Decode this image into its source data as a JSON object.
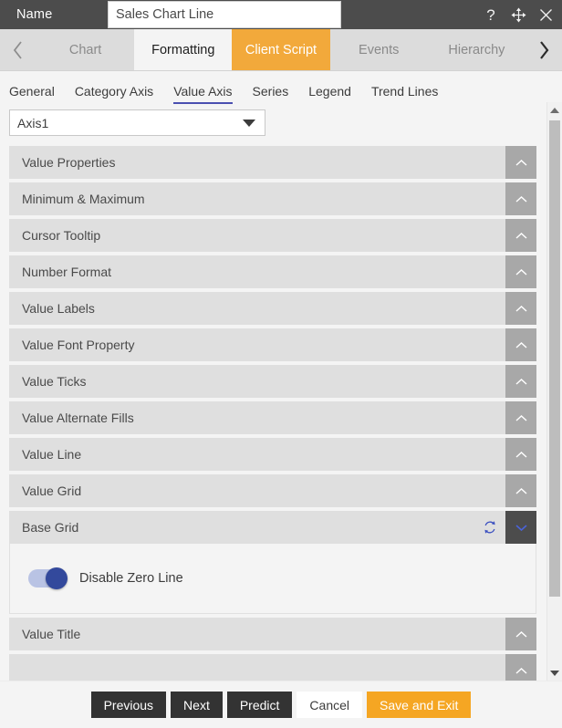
{
  "titlebar": {
    "name_label": "Name",
    "name_value": "Sales Chart Line",
    "name_placeholder": "Name",
    "help_icon": "question-mark-icon",
    "move_icon": "move-icon",
    "close_icon": "close-icon"
  },
  "tabstrip": {
    "prev_icon": "chevron-left-icon",
    "next_icon": "chevron-right-icon",
    "tabs": [
      {
        "label": "Chart",
        "state": "inactive"
      },
      {
        "label": "Formatting",
        "state": "active"
      },
      {
        "label": "Client Script",
        "state": "highlight"
      },
      {
        "label": "Events",
        "state": "inactive"
      },
      {
        "label": "Hierarchy",
        "state": "inactive"
      }
    ]
  },
  "subtabs": {
    "items": [
      {
        "label": "General",
        "active": false
      },
      {
        "label": "Category Axis",
        "active": false
      },
      {
        "label": "Value Axis",
        "active": true
      },
      {
        "label": "Series",
        "active": false
      },
      {
        "label": "Legend",
        "active": false
      },
      {
        "label": "Trend Lines",
        "active": false
      }
    ],
    "underline_color": "#4a4fb0"
  },
  "axis_select": {
    "value": "Axis1",
    "caret_icon": "caret-down-icon"
  },
  "accordion": {
    "collapse_icon": "chevron-up-icon",
    "expand_icon": "chevron-down-icon",
    "refresh_icon": "refresh-icon",
    "sections": [
      {
        "label": "Value Properties",
        "expanded": false
      },
      {
        "label": "Minimum & Maximum",
        "expanded": false
      },
      {
        "label": "Cursor Tooltip",
        "expanded": false
      },
      {
        "label": "Number Format",
        "expanded": false
      },
      {
        "label": "Value Labels",
        "expanded": false
      },
      {
        "label": "Value Font Property",
        "expanded": false
      },
      {
        "label": "Value Ticks",
        "expanded": false
      },
      {
        "label": "Value Alternate Fills",
        "expanded": false
      },
      {
        "label": "Value Line",
        "expanded": false
      },
      {
        "label": "Value Grid",
        "expanded": false
      },
      {
        "label": "Base Grid",
        "expanded": true,
        "has_refresh": true
      },
      {
        "label": "Value Title",
        "expanded": false
      },
      {
        "label": "",
        "expanded": false
      }
    ],
    "base_grid_body": {
      "toggle_label": "Disable Zero Line",
      "toggle_on": true,
      "toggle_on_color": "#33499c",
      "toggle_track_color": "#b9c3e4"
    }
  },
  "scrollbar": {
    "up_icon": "scroll-up-arrow-icon",
    "down_icon": "scroll-down-arrow-icon"
  },
  "footer": {
    "buttons": [
      {
        "label": "Previous",
        "style": "dark"
      },
      {
        "label": "Next",
        "style": "dark"
      },
      {
        "label": "Predict",
        "style": "dark"
      },
      {
        "label": "Cancel",
        "style": "light"
      },
      {
        "label": "Save and Exit",
        "style": "accent"
      }
    ]
  },
  "colors": {
    "header_bg": "#4c4c4c",
    "accent_orange": "#f2a93b",
    "tab_bg": "#dcdcdc",
    "accordion_header": "#dfdfdf",
    "accordion_toggle": "#a8a8a8",
    "accordion_toggle_open": "#4c4c4c",
    "refresh_blue": "#3a4fc0"
  }
}
